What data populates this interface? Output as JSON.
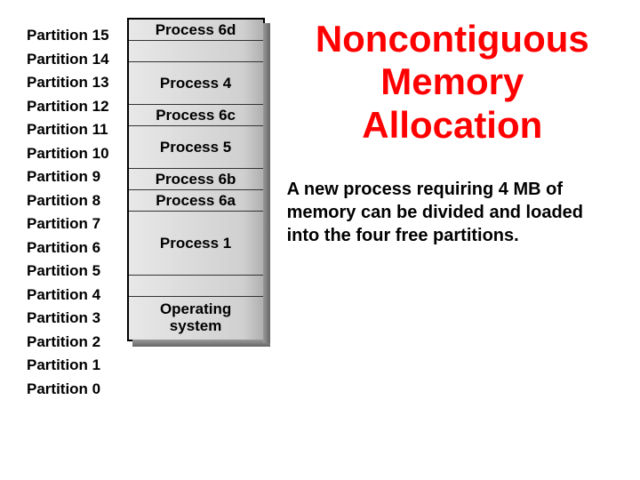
{
  "partitions": [
    {
      "label": "Partition 15"
    },
    {
      "label": "Partition 14"
    },
    {
      "label": "Partition 13"
    },
    {
      "label": "Partition 12"
    },
    {
      "label": "Partition 11"
    },
    {
      "label": "Partition 10"
    },
    {
      "label": "Partition 9"
    },
    {
      "label": "Partition 8"
    },
    {
      "label": "Partition 7"
    },
    {
      "label": "Partition 6"
    },
    {
      "label": "Partition 5"
    },
    {
      "label": "Partition 4"
    },
    {
      "label": "Partition 3"
    },
    {
      "label": "Partition 2"
    },
    {
      "label": "Partition 1"
    },
    {
      "label": "Partition 0"
    }
  ],
  "memory_blocks": [
    {
      "label": "Process 6d",
      "height": "h1"
    },
    {
      "label": "",
      "height": "h1"
    },
    {
      "label": "Process 4",
      "height": "h2"
    },
    {
      "label": "Process 6c",
      "height": "h1"
    },
    {
      "label": "Process 5",
      "height": "h2"
    },
    {
      "label": "Process 6b",
      "height": "h1"
    },
    {
      "label": "Process 6a",
      "height": "h1"
    },
    {
      "label": "Process 1",
      "height": "h3"
    },
    {
      "label": "",
      "height": "h1"
    },
    {
      "label": "Operating<br>system",
      "height": "h2"
    }
  ],
  "title": "Noncontiguous Memory Allocation",
  "body": "A new process requiring 4 MB of memory can be divided and loaded into the four free partitions."
}
